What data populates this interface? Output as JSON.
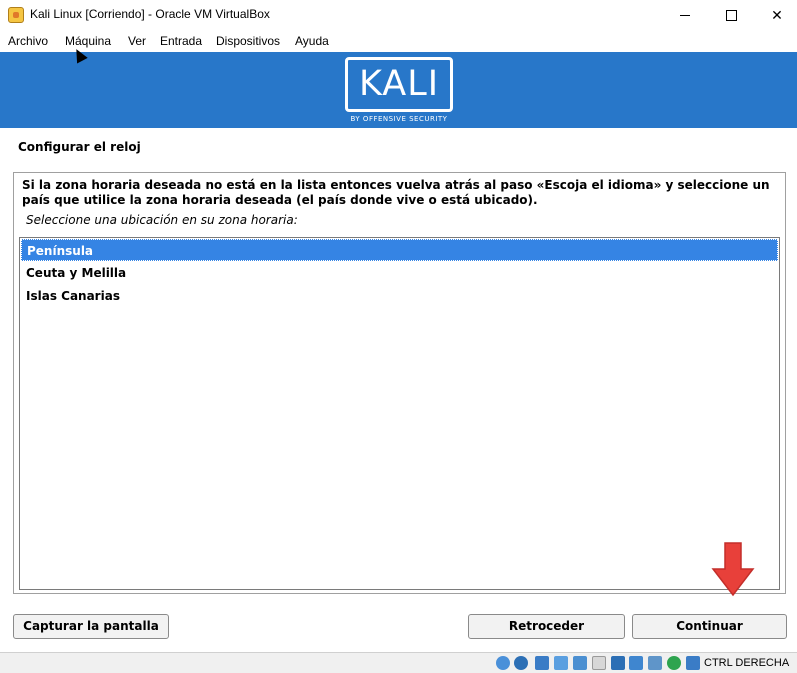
{
  "window": {
    "title": "Kali Linux [Corriendo] - Oracle VM VirtualBox",
    "close_glyph": "✕"
  },
  "menubar": {
    "items": [
      "Archivo",
      "Máquina",
      "Ver",
      "Entrada",
      "Dispositivos",
      "Ayuda"
    ]
  },
  "banner": {
    "logo": "KALI",
    "tagline": "BY OFFENSIVE SECURITY",
    "color": "#2877c9"
  },
  "installer": {
    "title": "Configurar el reloj",
    "instruction": "Si la zona horaria deseada no está en la lista entonces vuelva atrás al paso «Escoja el idioma» y seleccione un país que utilice la zona horaria deseada (el país donde vive o está ubicado).",
    "hint": "Seleccione una ubicación en su zona horaria:",
    "options": [
      "Península",
      "Ceuta y Melilla",
      "Islas Canarias"
    ],
    "selected_index": 0,
    "selection_color": "#3584e4"
  },
  "buttons": {
    "screenshot": "Capturar la pantalla",
    "back": "Retroceder",
    "continue": "Continuar"
  },
  "annotation": {
    "arrow_color": "#e8403a",
    "icon": "down-arrow-icon"
  },
  "statusbar": {
    "host_key": "CTRL DERECHA",
    "icons": [
      "hard-disk-icon",
      "optical-drive-icon",
      "audio-icon",
      "network-icon",
      "usb-icon",
      "shared-folders-icon",
      "display-icon",
      "recording-icon",
      "vm-state-icon",
      "vrde-icon",
      "mouse-integration-icon",
      "keyboard-capture-icon"
    ]
  }
}
